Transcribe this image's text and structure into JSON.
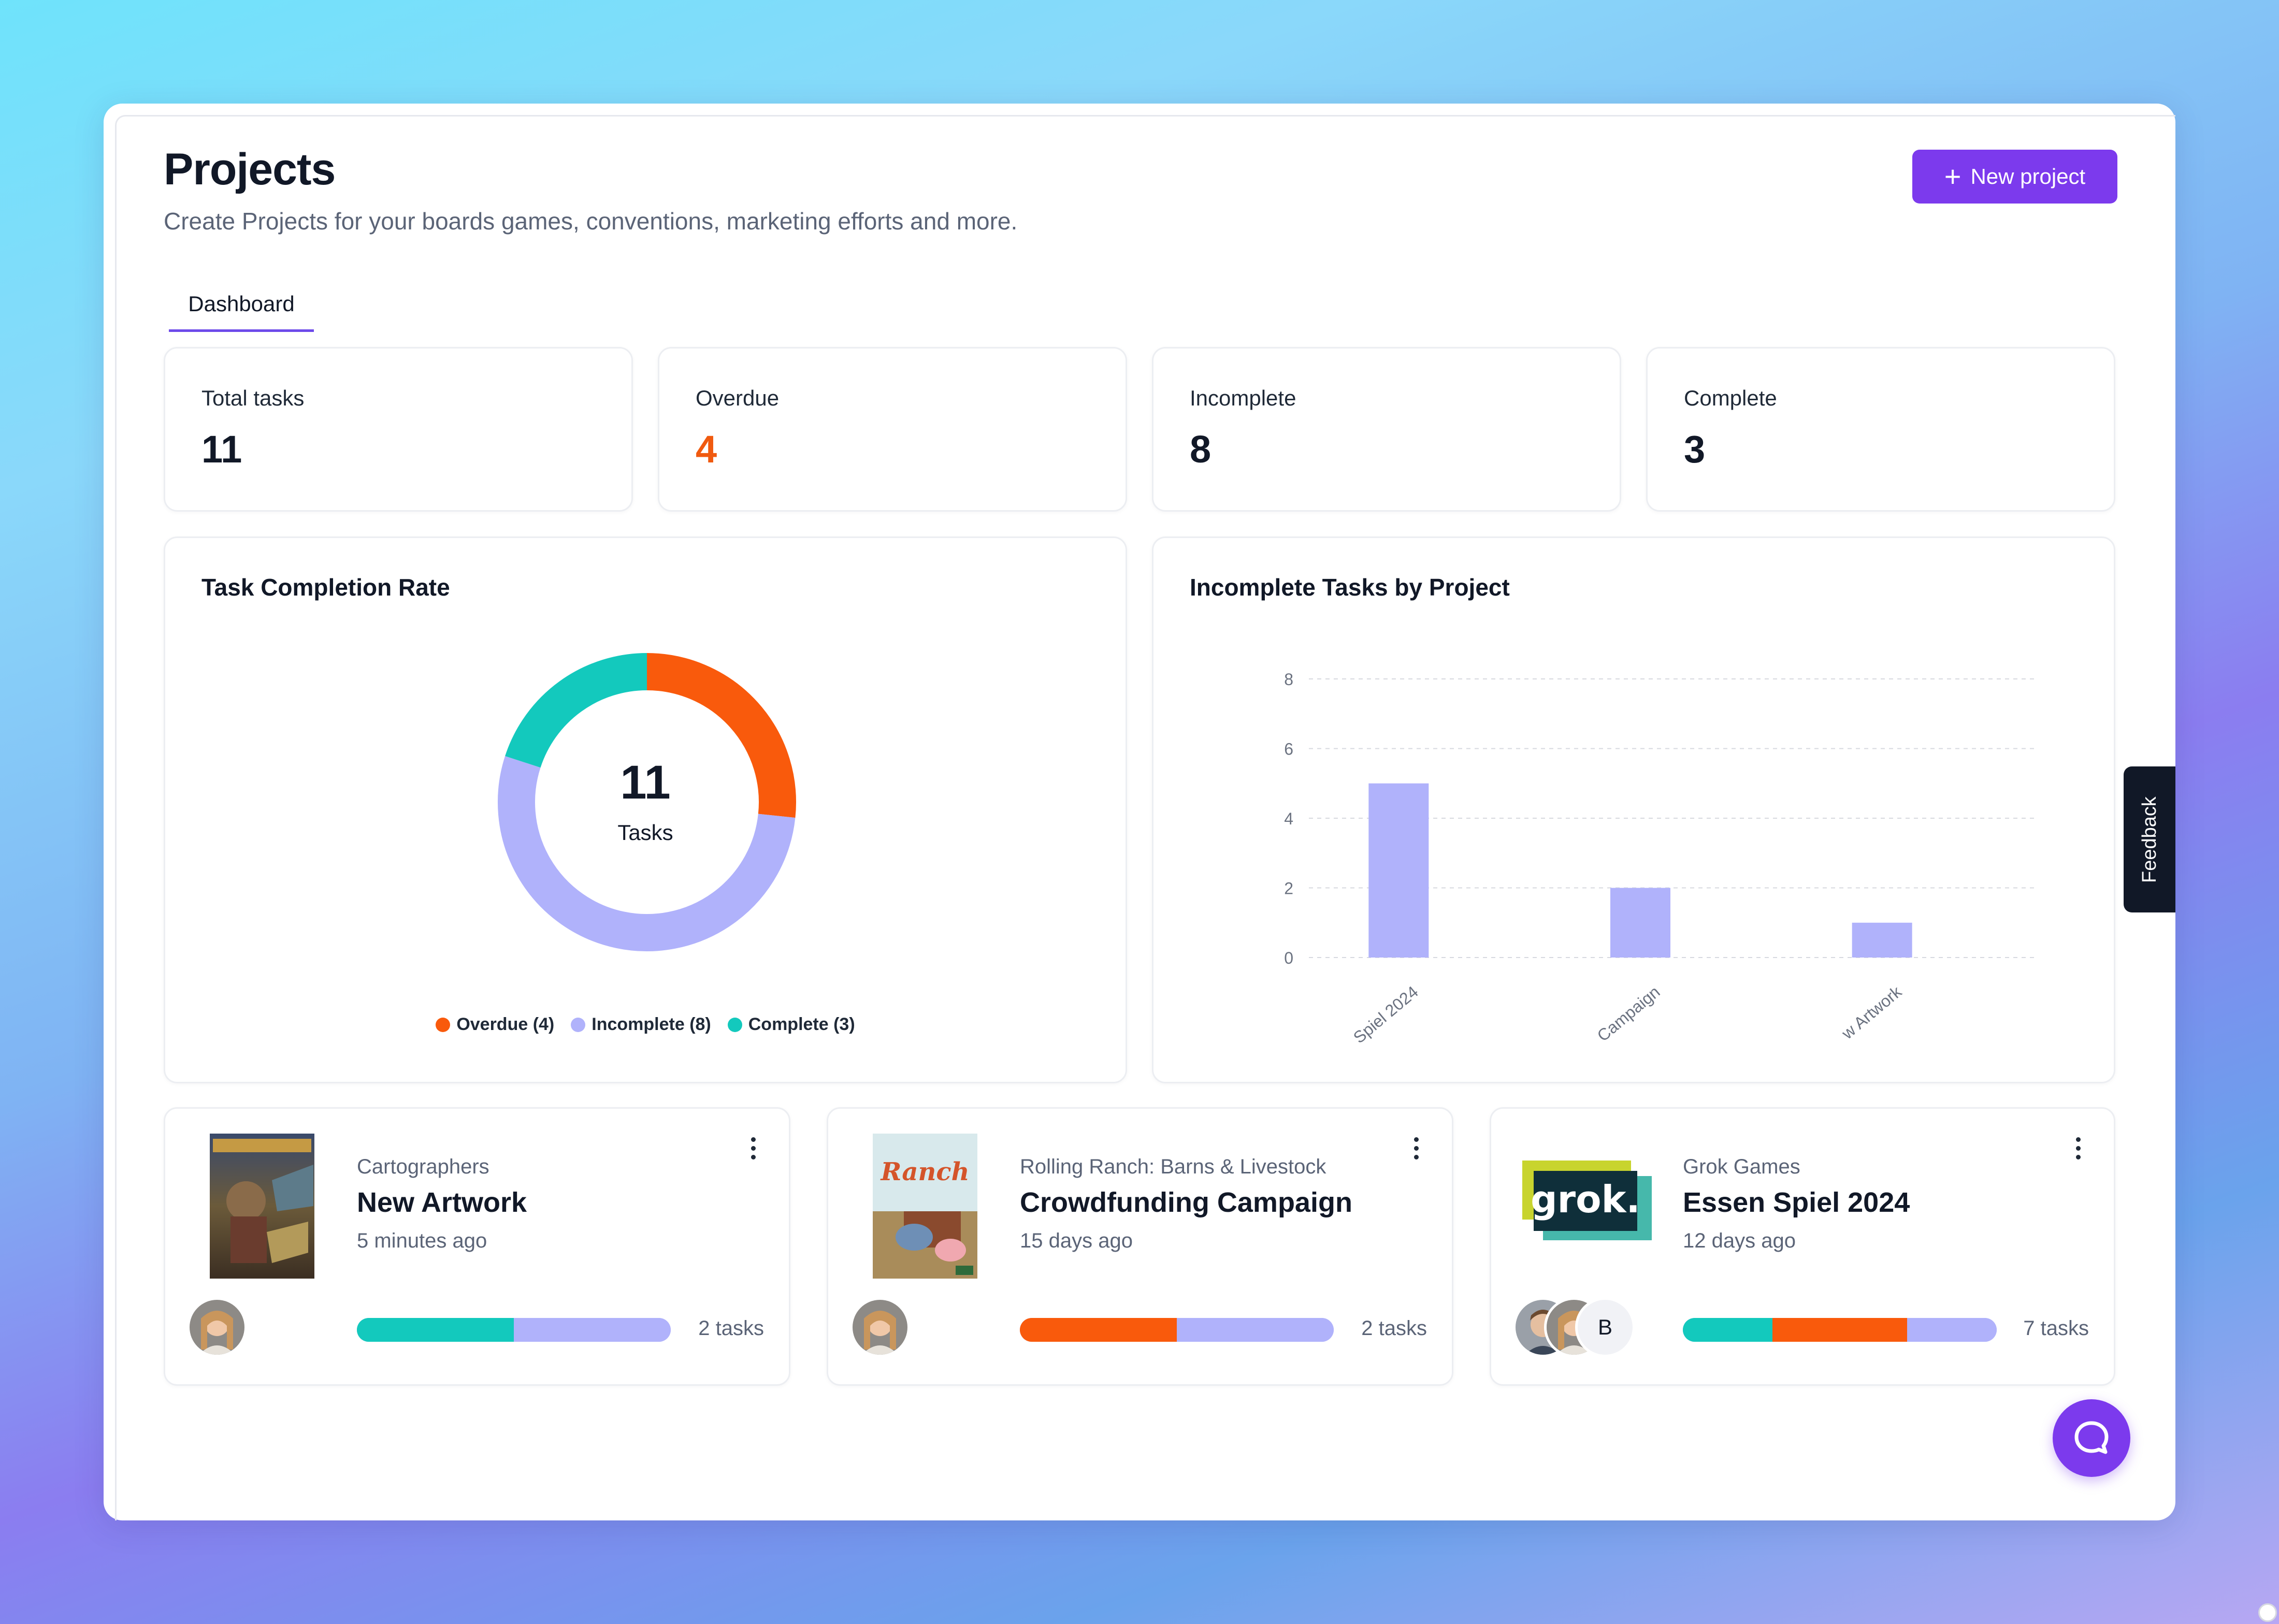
{
  "header": {
    "title": "Projects",
    "subtitle": "Create Projects for your boards games, conventions, marketing efforts and more.",
    "new_project_label": "New project"
  },
  "tabs": [
    {
      "label": "Dashboard",
      "active": true
    }
  ],
  "stats": [
    {
      "label": "Total tasks",
      "value": "11"
    },
    {
      "label": "Overdue",
      "value": "4",
      "color": "#f05a0f"
    },
    {
      "label": "Incomplete",
      "value": "8"
    },
    {
      "label": "Complete",
      "value": "3"
    }
  ],
  "completion_panel": {
    "title": "Task Completion Rate",
    "center_value": "11",
    "center_label": "Tasks",
    "legend": [
      {
        "label": "Overdue (4)",
        "color": "#f95a0c"
      },
      {
        "label": "Incomplete (8)",
        "color": "#b0b2fb"
      },
      {
        "label": "Complete (3)",
        "color": "#13c9bd"
      }
    ]
  },
  "incomplete_panel": {
    "title": "Incomplete Tasks by Project"
  },
  "chart_data": [
    {
      "type": "pie",
      "title": "Task Completion Rate",
      "categories": [
        "Overdue",
        "Incomplete",
        "Complete"
      ],
      "values": [
        4,
        8,
        3
      ],
      "colors": [
        "#f95a0c",
        "#b0b2fb",
        "#13c9bd"
      ],
      "legend": "bottom",
      "center_text": "11 Tasks"
    },
    {
      "type": "bar",
      "title": "Incomplete Tasks by Project",
      "categories": [
        "Spiel 2024",
        "Campaign",
        "w Artwork"
      ],
      "values": [
        5,
        2,
        1
      ],
      "yticks": [
        "0",
        "2",
        "4",
        "6",
        "8"
      ],
      "ylim": [
        0,
        8
      ],
      "grid": true,
      "bar_color": "#b0b2fb"
    }
  ],
  "projects": [
    {
      "client": "Cartographers",
      "name": "New Artwork",
      "time": "5 minutes ago",
      "tasks_label": "2 tasks",
      "progress": [
        {
          "color": "#13c9bd",
          "fraction": 0.5
        },
        {
          "color": "#b0b2fb",
          "fraction": 0.5
        }
      ],
      "thumbnail_icon": "cartographers-box-art-icon"
    },
    {
      "client": "Rolling Ranch: Barns & Livestock",
      "name": "Crowdfunding Campaign",
      "time": "15 days ago",
      "tasks_label": "2 tasks",
      "progress": [
        {
          "color": "#f95a0c",
          "fraction": 0.5
        },
        {
          "color": "#b0b2fb",
          "fraction": 0.5
        }
      ],
      "thumbnail_icon": "rolling-ranch-box-art-icon",
      "thumbnail_text": "Ranch"
    },
    {
      "client": "Grok Games",
      "name": "Essen Spiel 2024",
      "time": "12 days ago",
      "tasks_label": "7 tasks",
      "progress": [
        {
          "color": "#13c9bd",
          "fraction": 0.286
        },
        {
          "color": "#f95a0c",
          "fraction": 0.428
        },
        {
          "color": "#b0b2fb",
          "fraction": 0.286
        }
      ],
      "thumbnail_icon": "grok-logo-icon",
      "logo_text": "grok.",
      "avatar_initial": "B"
    }
  ],
  "feedback_label": "Feedback",
  "colors": {
    "accent": "#7c3aed",
    "overdue": "#f95a0c",
    "incomplete": "#b0b2fb",
    "complete": "#13c9bd"
  }
}
